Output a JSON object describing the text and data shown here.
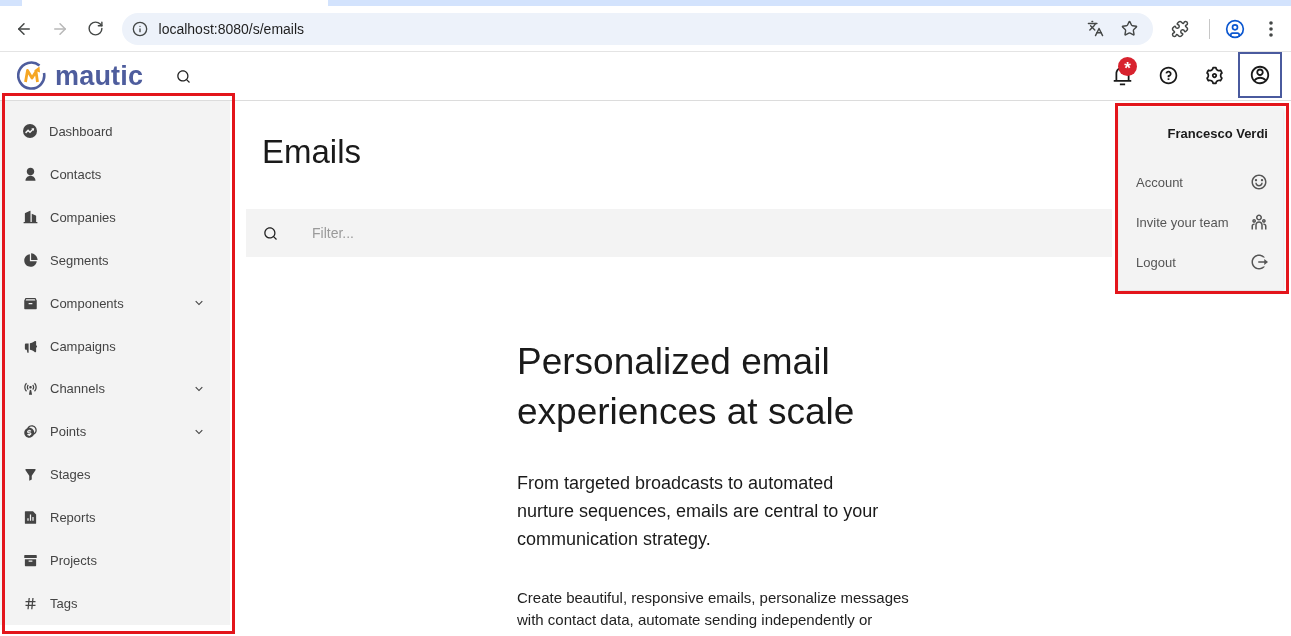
{
  "browser": {
    "back": {
      "disabled": false
    },
    "forward": {
      "disabled": true
    },
    "url": "localhost:8080/s/emails"
  },
  "header": {
    "logo": "mautic",
    "notifications": {
      "badge": "*"
    },
    "user_menu": {
      "expanded": true,
      "highlighted": true,
      "name": "Francesco Verdi",
      "items": [
        {
          "label": "Account"
        },
        {
          "label": "Invite your team"
        },
        {
          "label": "Logout"
        }
      ]
    }
  },
  "sidebar": {
    "highlighted": true,
    "items": [
      {
        "label": "Dashboard",
        "expandable": false
      },
      {
        "label": "Contacts",
        "expandable": false
      },
      {
        "label": "Companies",
        "expandable": false
      },
      {
        "label": "Segments",
        "expandable": false
      },
      {
        "label": "Components",
        "expandable": true
      },
      {
        "label": "Campaigns",
        "expandable": false
      },
      {
        "label": "Channels",
        "expandable": true
      },
      {
        "label": "Points",
        "expandable": true
      },
      {
        "label": "Stages",
        "expandable": false
      },
      {
        "label": "Reports",
        "expandable": false
      },
      {
        "label": "Projects",
        "expandable": false
      },
      {
        "label": "Tags",
        "expandable": false
      }
    ]
  },
  "page": {
    "title": "Emails",
    "filter": {
      "placeholder": "Filter..."
    },
    "hero": {
      "heading": "Personalized email experiences at scale",
      "subtitle": "From targeted broadcasts to automated nurture sequences, emails are central to your communication strategy.",
      "body": "Create beautiful, responsive emails, personalize messages with contact data, automate sending independently or"
    }
  }
}
